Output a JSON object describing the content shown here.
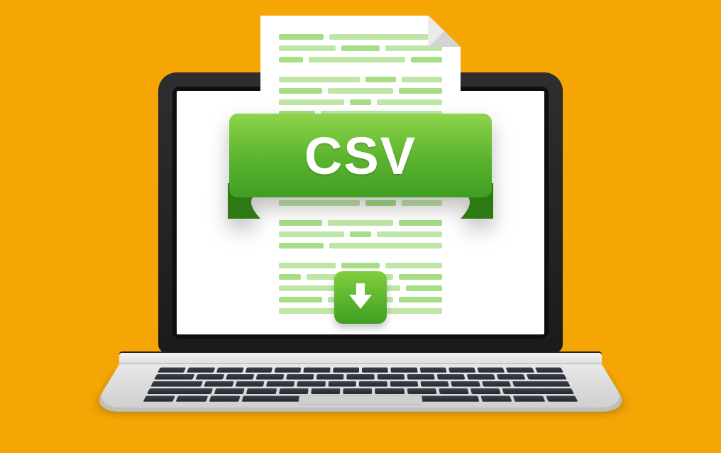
{
  "banner": {
    "label": "CSV"
  },
  "icons": {
    "download": "download-arrow-icon",
    "document": "document-with-fold-icon",
    "laptop": "laptop-icon"
  },
  "colors": {
    "background": "#f5a605",
    "banner_top": "#8ed44b",
    "banner_bottom": "#3f9e22",
    "doc_line_light": "#bfe6a7",
    "doc_line_dark": "#a7dd85"
  }
}
